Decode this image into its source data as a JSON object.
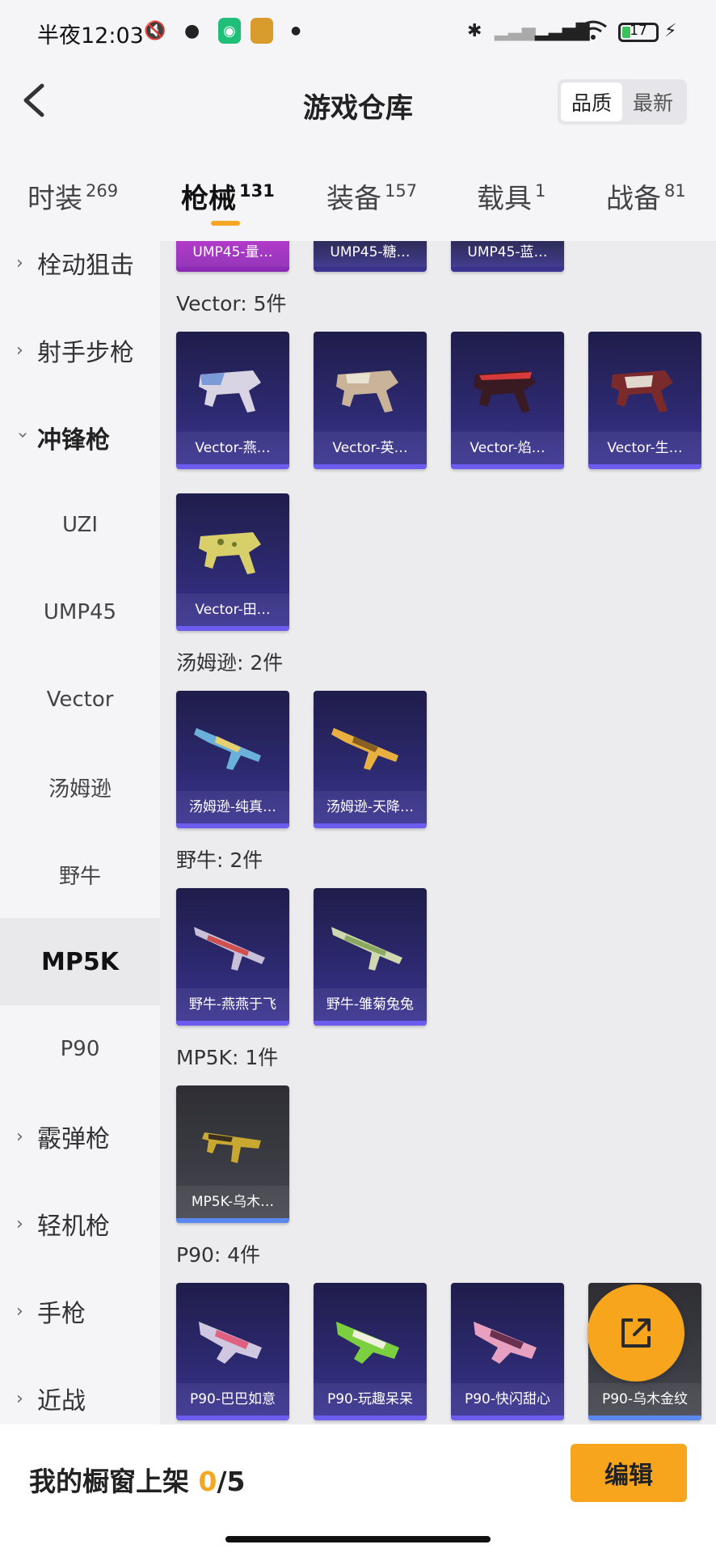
{
  "status": {
    "time": "半夜12:03",
    "battery": "17"
  },
  "header": {
    "title": "游戏仓库",
    "sort": [
      "品质",
      "最新"
    ]
  },
  "tabs": [
    {
      "label": "时装",
      "count": "269"
    },
    {
      "label": "枪械",
      "count": "131"
    },
    {
      "label": "装备",
      "count": "157"
    },
    {
      "label": "载具",
      "count": "1"
    },
    {
      "label": "战备",
      "count": "81"
    }
  ],
  "sidebar": {
    "groups": [
      "栓动狙击",
      "射手步枪",
      "冲锋枪",
      "霰弹枪",
      "轻机枪",
      "手枪",
      "近战"
    ],
    "subs": [
      "UZI",
      "UMP45",
      "Vector",
      "汤姆逊",
      "野牛",
      "MP5K",
      "P90"
    ]
  },
  "groups": [
    {
      "title": "",
      "items": [
        "UMP45-量…",
        "UMP45-糖…",
        "UMP45-蓝…"
      ]
    },
    {
      "title": "Vector: 5件",
      "items": [
        "Vector-燕…",
        "Vector-英…",
        "Vector-焰…",
        "Vector-生…",
        "Vector-田…"
      ]
    },
    {
      "title": "汤姆逊: 2件",
      "items": [
        "汤姆逊-纯真…",
        "汤姆逊-天降…"
      ]
    },
    {
      "title": "野牛: 2件",
      "items": [
        "野牛-燕燕于飞",
        "野牛-雏菊兔兔"
      ]
    },
    {
      "title": "MP5K: 1件",
      "items": [
        "MP5K-乌木…"
      ]
    },
    {
      "title": "P90: 4件",
      "items": [
        "P90-巴巴如意",
        "P90-玩趣呆呆",
        "P90-快闪甜心",
        "P90-乌木金纹"
      ]
    }
  ],
  "bottom": {
    "shelf_label": "我的橱窗上架 ",
    "current": "0",
    "total": "/5",
    "edit": "编辑"
  },
  "colors": {
    "accent": "#f6a51c",
    "card_bg": "#2e2a72",
    "card_bar": "#6c5cf0"
  }
}
